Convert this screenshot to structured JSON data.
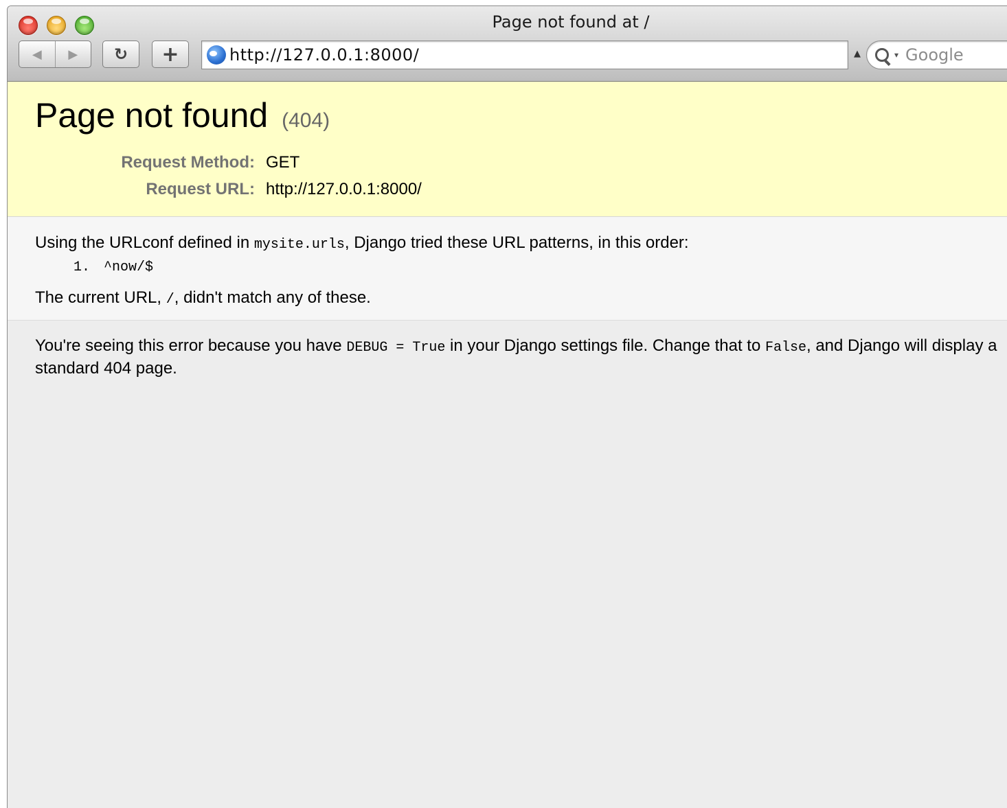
{
  "window": {
    "title": "Page not found at /"
  },
  "toolbar": {
    "back_icon": "◀",
    "forward_icon": "▶",
    "reload_icon": "↻",
    "add_bookmark_icon": "+",
    "url": "http://127.0.0.1:8000/",
    "search_placeholder": "Google"
  },
  "error": {
    "heading": "Page not found",
    "status_code": "(404)",
    "request_method_label": "Request Method:",
    "request_method_value": "GET",
    "request_url_label": "Request URL:",
    "request_url_value": "http://127.0.0.1:8000/"
  },
  "info": {
    "intro_before": "Using the URLconf defined in ",
    "intro_code": "mysite.urls",
    "intro_after": ", Django tried these URL patterns, in this order:",
    "patterns": [
      {
        "number": "1.",
        "pattern": "^now/$"
      }
    ],
    "current_before": "The current URL, ",
    "current_code": "/",
    "current_after": ", didn't match any of these."
  },
  "explanation": {
    "part1": "You're seeing this error because you have ",
    "code1": "DEBUG = True",
    "part2": " in your Django settings file. Change that to ",
    "code2": "False",
    "part3": ", and Django will display a standard 404 page."
  }
}
